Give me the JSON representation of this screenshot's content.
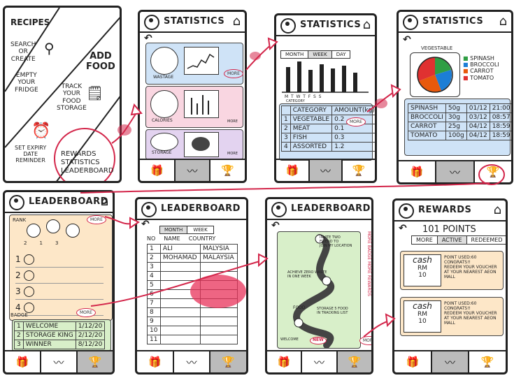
{
  "home": {
    "recipes": "RECIPES",
    "search_create": "SEARCH\nOR\nCREATE",
    "add_food": "ADD\nFOOD",
    "empty_fridge": "EMPTY\nYOUR\nFRIDGE",
    "track_food": "TRACK\nYOUR\nFOOD\nSTORAGE",
    "set_expiry": "SET EXPIRY\nDATE\nREMINDER",
    "rewards_menu": "REWARDS\nSTATISTICS\nLEADERBOARD"
  },
  "stats1": {
    "title": "STATISTICS",
    "wastage": "WASTAGE",
    "calories": "CALORIES",
    "storage": "STORAGE",
    "more": "MORE"
  },
  "stats2": {
    "title": "STATISTICS",
    "tabs": [
      "MONTH",
      "WEEK",
      "DAY"
    ],
    "days": "M  T  W  T  F  S  S",
    "category_label": "CATEGORY",
    "col_category": "CATEGORY",
    "col_amount": "AMOUNT(kg)",
    "rows": [
      {
        "n": "1",
        "cat": "VEGETABLE",
        "amt": "0.2"
      },
      {
        "n": "2",
        "cat": "MEAT",
        "amt": "0.1"
      },
      {
        "n": "3",
        "cat": "FISH",
        "amt": "0.3"
      },
      {
        "n": "4",
        "cat": "ASSORTED",
        "amt": "1.2"
      }
    ],
    "more": "MORE"
  },
  "stats3": {
    "title": "STATISTICS",
    "subtitle": "VEGESTABLE",
    "legend": [
      "SPINASH",
      "BROCCOLI",
      "CARROT",
      "TOMATO"
    ],
    "legend_colors": [
      "#2f9e44",
      "#1c7ed6",
      "#e8590c",
      "#e03131"
    ],
    "rows": [
      {
        "name": "SPINASH",
        "qty": "50g",
        "date": "01/12",
        "time": "21:00"
      },
      {
        "name": "BROCCOLI",
        "qty": "30g",
        "date": "03/12",
        "time": "08:57"
      },
      {
        "name": "CARROT",
        "qty": "25g",
        "date": "04/12",
        "time": "18:59"
      },
      {
        "name": "TOMATO",
        "qty": "100g",
        "date": "04/12",
        "time": "18:59"
      }
    ]
  },
  "lead1": {
    "title": "LEADERBOARD",
    "rank": "RANK",
    "ranks": [
      "1",
      "2",
      "3",
      "4"
    ],
    "podium": [
      "2",
      "1",
      "3"
    ],
    "badge": "BADGE",
    "more": "MORE",
    "badges": [
      {
        "n": "1",
        "name": "WELCOME",
        "date": "1/12/20"
      },
      {
        "n": "2",
        "name": "STORAGE KING",
        "date": "2/12/20"
      },
      {
        "n": "3",
        "name": "WINNER",
        "date": "8/12/20"
      }
    ]
  },
  "lead2": {
    "title": "LEADERBOARD",
    "tabs": [
      "MONTH",
      "WEEK"
    ],
    "col_no": "NO",
    "col_name": "NAME",
    "col_country": "COUNTRY",
    "rows": [
      {
        "n": "1",
        "name": "ALI",
        "country": "MALYSIA"
      },
      {
        "n": "2",
        "name": "MOHAMAD",
        "country": "MALAYSIA"
      },
      {
        "n": "3",
        "name": "",
        "country": ""
      },
      {
        "n": "4",
        "name": "",
        "country": ""
      },
      {
        "n": "5",
        "name": "",
        "country": ""
      },
      {
        "n": "6",
        "name": "",
        "country": ""
      },
      {
        "n": "7",
        "name": "",
        "country": ""
      },
      {
        "n": "8",
        "name": "",
        "country": ""
      },
      {
        "n": "9",
        "name": "",
        "country": ""
      },
      {
        "n": "10",
        "name": "",
        "country": ""
      },
      {
        "n": "11",
        "name": "",
        "country": ""
      }
    ]
  },
  "lead3": {
    "title": "LEADERBOARD",
    "invite": "INVITE TWO\nFRIEND TO\nJOIN MY LOCATION",
    "zero_waste": "ACHIEVE ZERO WASTE\nIN ONE WEEK",
    "food": "FOOD",
    "storage5": "STORAGE 5 FOOD\nIN TRACKING LIST",
    "welcome": "WELCOME",
    "new": "NEW",
    "side": "MORE BADGE    MORE REWARDS",
    "more": "MORE"
  },
  "rewards": {
    "title": "REWARDS",
    "points": "101 POINTS",
    "tabs": [
      "MORE",
      "ACTIVE",
      "REDEEMED"
    ],
    "cards": [
      {
        "cash": "cash",
        "rm": "RM",
        "amt": "10",
        "text": "POINT USED:60\nCONGRATS!!\nREDEEM YOUR VOUCHER\nAT YOUR NEAREST AEON\nMALL"
      },
      {
        "cash": "cash",
        "rm": "RM",
        "amt": "10",
        "text": "POINT USED:60\nCONGRATS!!\nREDEEM YOUR VOUCHER\nAT YOUR NEAREST AEON\nMALL"
      }
    ]
  },
  "nav_icons": [
    "gift-icon",
    "chart-icon",
    "trophy-icon"
  ],
  "colors": {
    "accent": "#d3264a",
    "blue": "#cfe3f7",
    "pink": "#f9d6e1",
    "purple": "#e3d3f0",
    "green": "#d8efc9",
    "orange": "#fde7c8"
  }
}
